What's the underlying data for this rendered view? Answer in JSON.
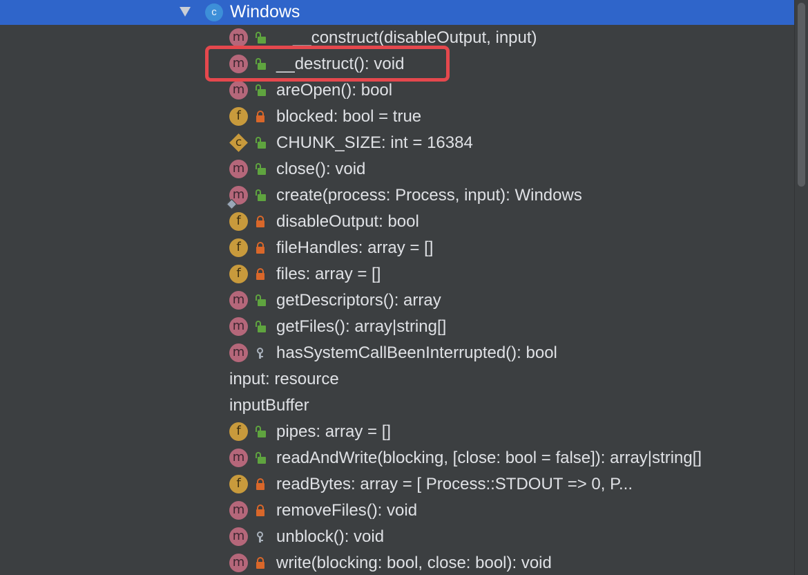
{
  "tree": {
    "class_node": {
      "icon_letter": "c",
      "label": "Windows"
    },
    "members": [
      {
        "kind": "method",
        "kind_letter": "m",
        "visibility": "public",
        "label": "__construct(disableOutput, input)",
        "indent": true
      },
      {
        "kind": "method",
        "kind_letter": "m",
        "visibility": "public",
        "label": "__destruct(): void",
        "highlighted": true
      },
      {
        "kind": "method",
        "kind_letter": "m",
        "visibility": "public",
        "label": "areOpen(): bool"
      },
      {
        "kind": "field",
        "kind_letter": "f",
        "visibility": "private",
        "label": "blocked: bool = true"
      },
      {
        "kind": "constant",
        "kind_letter": "c",
        "visibility": "public",
        "label": "CHUNK_SIZE: int = 16384"
      },
      {
        "kind": "method",
        "kind_letter": "m",
        "visibility": "public",
        "label": "close(): void"
      },
      {
        "kind": "method",
        "kind_letter": "m",
        "visibility": "public",
        "label": "create(process: Process, input): Windows",
        "static_mark": true
      },
      {
        "kind": "field",
        "kind_letter": "f",
        "visibility": "private",
        "label": "disableOutput: bool"
      },
      {
        "kind": "field",
        "kind_letter": "f",
        "visibility": "private",
        "label": "fileHandles: array = []"
      },
      {
        "kind": "field",
        "kind_letter": "f",
        "visibility": "private",
        "label": "files: array = []"
      },
      {
        "kind": "method",
        "kind_letter": "m",
        "visibility": "public",
        "label": "getDescriptors(): array"
      },
      {
        "kind": "method",
        "kind_letter": "m",
        "visibility": "public",
        "label": "getFiles(): array|string[]"
      },
      {
        "kind": "method",
        "kind_letter": "m",
        "visibility": "protected",
        "label": "hasSystemCallBeenInterrupted(): bool"
      },
      {
        "kind": "plain",
        "label": "input: resource"
      },
      {
        "kind": "plain",
        "label": "inputBuffer"
      },
      {
        "kind": "field",
        "kind_letter": "f",
        "visibility": "public",
        "label": "pipes: array = []"
      },
      {
        "kind": "method",
        "kind_letter": "m",
        "visibility": "public",
        "label": "readAndWrite(blocking, [close: bool = false]): array|string[]"
      },
      {
        "kind": "field",
        "kind_letter": "f",
        "visibility": "private",
        "label": "readBytes: array = [ Process::STDOUT => 0, P..."
      },
      {
        "kind": "method",
        "kind_letter": "m",
        "visibility": "private",
        "label": "removeFiles(): void"
      },
      {
        "kind": "method",
        "kind_letter": "m",
        "visibility": "protected",
        "label": "unblock(): void"
      },
      {
        "kind": "method",
        "kind_letter": "m",
        "visibility": "private",
        "label": "write(blocking: bool, close: bool): void"
      }
    ]
  },
  "colors": {
    "background": "#3c3f41",
    "selection": "#2f65ca",
    "text": "#dfe1e5",
    "method_icon": "#b5677a",
    "field_icon": "#c89a3c",
    "public_lock": "#5fa43f",
    "private_lock": "#d9672a",
    "protected_key": "#a9b1bb",
    "highlight_box": "#e5484d"
  }
}
